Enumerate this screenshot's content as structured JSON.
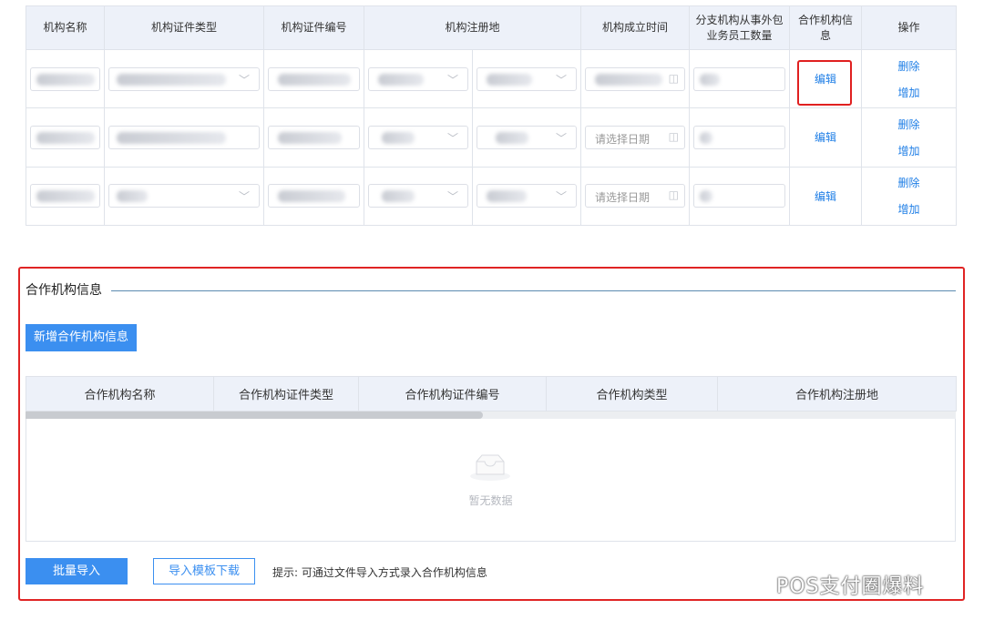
{
  "top_table": {
    "headers": [
      "机构名称",
      "机构证件类型",
      "机构证件编号",
      "机构注册地",
      "机构成立时间",
      "分支机构从事外包业务员工数量",
      "合作机构信息",
      "操作"
    ],
    "rows": [
      {
        "date_placeholder": "",
        "edit": "编辑",
        "delete": "删除",
        "add": "增加"
      },
      {
        "date_placeholder": "请选择日期",
        "edit": "编辑",
        "delete": "删除",
        "add": "增加"
      },
      {
        "date_placeholder": "请选择日期",
        "edit": "编辑",
        "delete": "删除",
        "add": "增加"
      }
    ]
  },
  "partner_section": {
    "title": "合作机构信息",
    "add_button": "新增合作机构信息",
    "columns": [
      "合作机构名称",
      "合作机构证件类型",
      "合作机构证件编号",
      "合作机构类型",
      "合作机构注册地"
    ],
    "empty_text": "暂无数据",
    "import_button": "批量导入",
    "template_button": "导入模板下载",
    "hint": "提示: 可通过文件导入方式录入合作机构信息"
  },
  "watermark": "POS支付圈爆料",
  "colors": {
    "accent": "#3b8ff0",
    "link": "#1e7ee6",
    "highlight": "#e02020",
    "header_bg": "#edf1f9"
  }
}
